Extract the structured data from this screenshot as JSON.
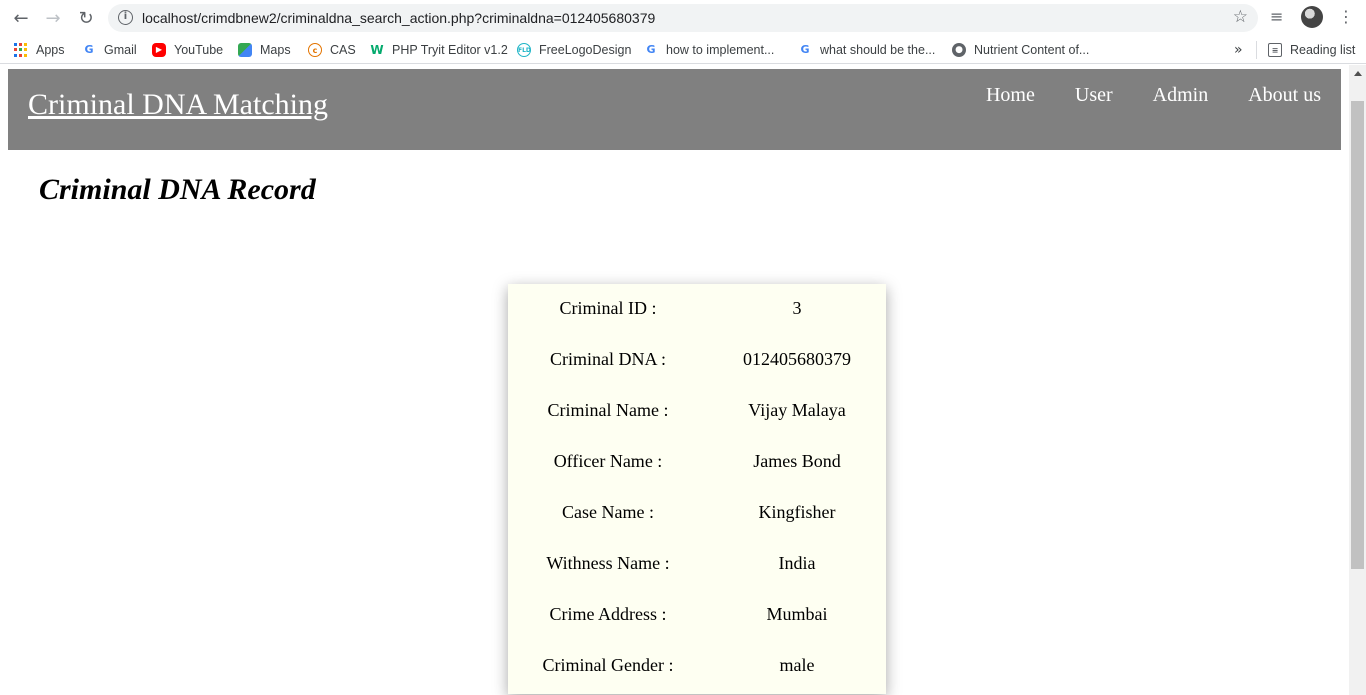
{
  "browser": {
    "url": "localhost/crimdbnew2/criminaldna_search_action.php?criminaldna=012405680379",
    "bookmarks": [
      {
        "label": "Apps",
        "icon": "apps-grid-icon"
      },
      {
        "label": "Gmail",
        "icon": "google-icon"
      },
      {
        "label": "YouTube",
        "icon": "youtube-icon"
      },
      {
        "label": "Maps",
        "icon": "maps-icon"
      },
      {
        "label": "CAS",
        "icon": "cas-icon"
      },
      {
        "label": "PHP Tryit Editor v1.2",
        "icon": "w3schools-icon"
      },
      {
        "label": "FreeLogoDesign",
        "icon": "freelogodesign-icon"
      },
      {
        "label": "how to implement...",
        "icon": "google-icon"
      },
      {
        "label": "what should be the...",
        "icon": "google-icon"
      },
      {
        "label": "Nutrient Content of...",
        "icon": "globe-icon"
      }
    ],
    "reading_list": "Reading list",
    "overflow_glyph": "»"
  },
  "site": {
    "brand": "Criminal DNA Matching",
    "nav": [
      "Home",
      "User",
      "Admin",
      "About us"
    ],
    "header_color": "#808080"
  },
  "page": {
    "title": "Criminal DNA Record"
  },
  "record": [
    {
      "label": "Criminal ID :",
      "value": "3"
    },
    {
      "label": "Criminal DNA :",
      "value": "012405680379"
    },
    {
      "label": "Criminal Name :",
      "value": "Vijay Malaya"
    },
    {
      "label": "Officer Name :",
      "value": "James Bond"
    },
    {
      "label": "Case Name :",
      "value": "Kingfisher"
    },
    {
      "label": "Withness Name :",
      "value": "India"
    },
    {
      "label": "Crime Address :",
      "value": "Mumbai"
    },
    {
      "label": "Criminal Gender :",
      "value": "male"
    }
  ],
  "colors": {
    "card_background": "#fefff2"
  }
}
